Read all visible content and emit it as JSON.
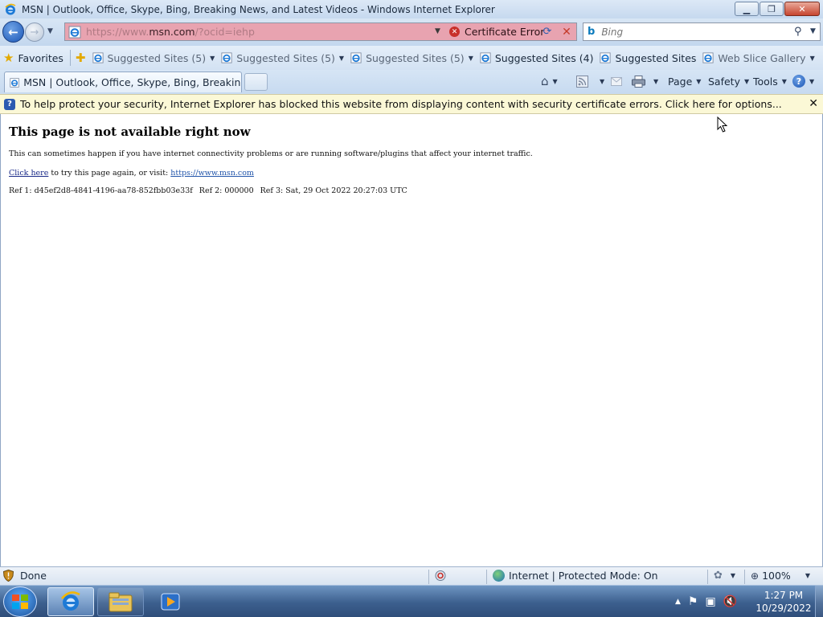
{
  "window": {
    "title": "MSN | Outlook, Office, Skype, Bing, Breaking News, and Latest Videos - Windows Internet Explorer",
    "minimize_glyph": "▁",
    "restore_glyph": "❐",
    "close_glyph": "✕"
  },
  "address": {
    "url_prefix": "https://www.",
    "url_domain": "msn.com",
    "url_suffix": "/?ocid=iehp",
    "cert_error_label": "Certificate Error"
  },
  "search": {
    "placeholder": "Bing",
    "provider_letter": "b"
  },
  "favorites_bar": {
    "favorites_label": "Favorites",
    "items": [
      {
        "label": "Suggested Sites (5)",
        "dim": true
      },
      {
        "label": "Suggested Sites (5)",
        "dim": true
      },
      {
        "label": "Suggested Sites (5)",
        "dim": true
      },
      {
        "label": "Suggested Sites (4)",
        "dim": false
      },
      {
        "label": "Suggested Sites",
        "dim": false
      },
      {
        "label": "Web Slice Gallery",
        "dim": true
      }
    ]
  },
  "tabs": [
    {
      "label": "MSN | Outlook, Office, Skype, Bing, Breaking Ne..."
    }
  ],
  "command_bar": {
    "page_label": "Page",
    "safety_label": "Safety",
    "tools_label": "Tools",
    "help_glyph": "?"
  },
  "info_bar": {
    "message": "To help protect your security, Internet Explorer has blocked this website from displaying content with security certificate errors. Click here for options...",
    "close_glyph": "✕"
  },
  "page": {
    "heading": "This page is not available right now",
    "description": "This can sometimes happen if you have internet connectivity problems or are running software/plugins that affect your internet traffic.",
    "retry_link": "Click here",
    "retry_text": " to try this page again, or visit: ",
    "visit_link": "https://www.msn.com",
    "ref1": "Ref 1: d45ef2d8-4841-4196-aa78-852fbb03e33f",
    "ref2": "Ref 2: 000000",
    "ref3": "Ref 3: Sat, 29 Oct 2022 20:27:03 UTC"
  },
  "status_bar": {
    "status_text": "Done",
    "zone_text": "Internet | Protected Mode: On",
    "zoom_text": "100%"
  },
  "taskbar": {
    "time": "1:27 PM",
    "date": "10/29/2022"
  },
  "colors": {
    "address_error_bg": "#e8a3b0",
    "info_bar_bg": "#fbf8d6",
    "taskbar_blue": "#3c5f8e"
  }
}
